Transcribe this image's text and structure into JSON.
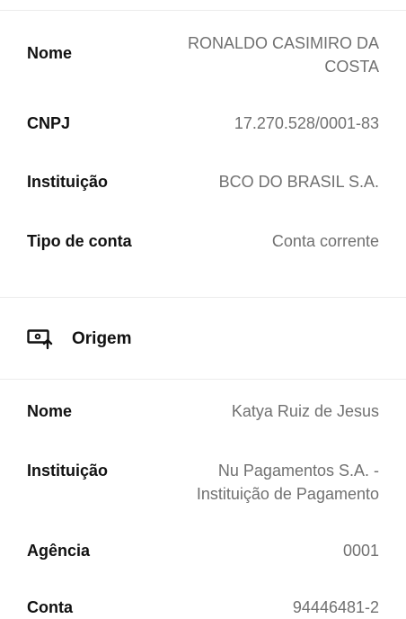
{
  "destination": {
    "rows": [
      {
        "label": "Nome",
        "value": "RONALDO CASIMIRO DA COSTA"
      },
      {
        "label": "CNPJ",
        "value": "17.270.528/0001-83"
      },
      {
        "label": "Instituição",
        "value": "BCO DO BRASIL S.A."
      },
      {
        "label": "Tipo de conta",
        "value": "Conta corrente"
      }
    ]
  },
  "origin": {
    "title": "Origem",
    "icon": "account-upload-icon",
    "rows": [
      {
        "label": "Nome",
        "value": "Katya Ruiz de Jesus"
      },
      {
        "label": "Instituição",
        "value": "Nu Pagamentos S.A. - Instituição de Pagamento"
      },
      {
        "label": "Agência",
        "value": "0001"
      },
      {
        "label": "Conta",
        "value": "94446481-2"
      }
    ]
  }
}
